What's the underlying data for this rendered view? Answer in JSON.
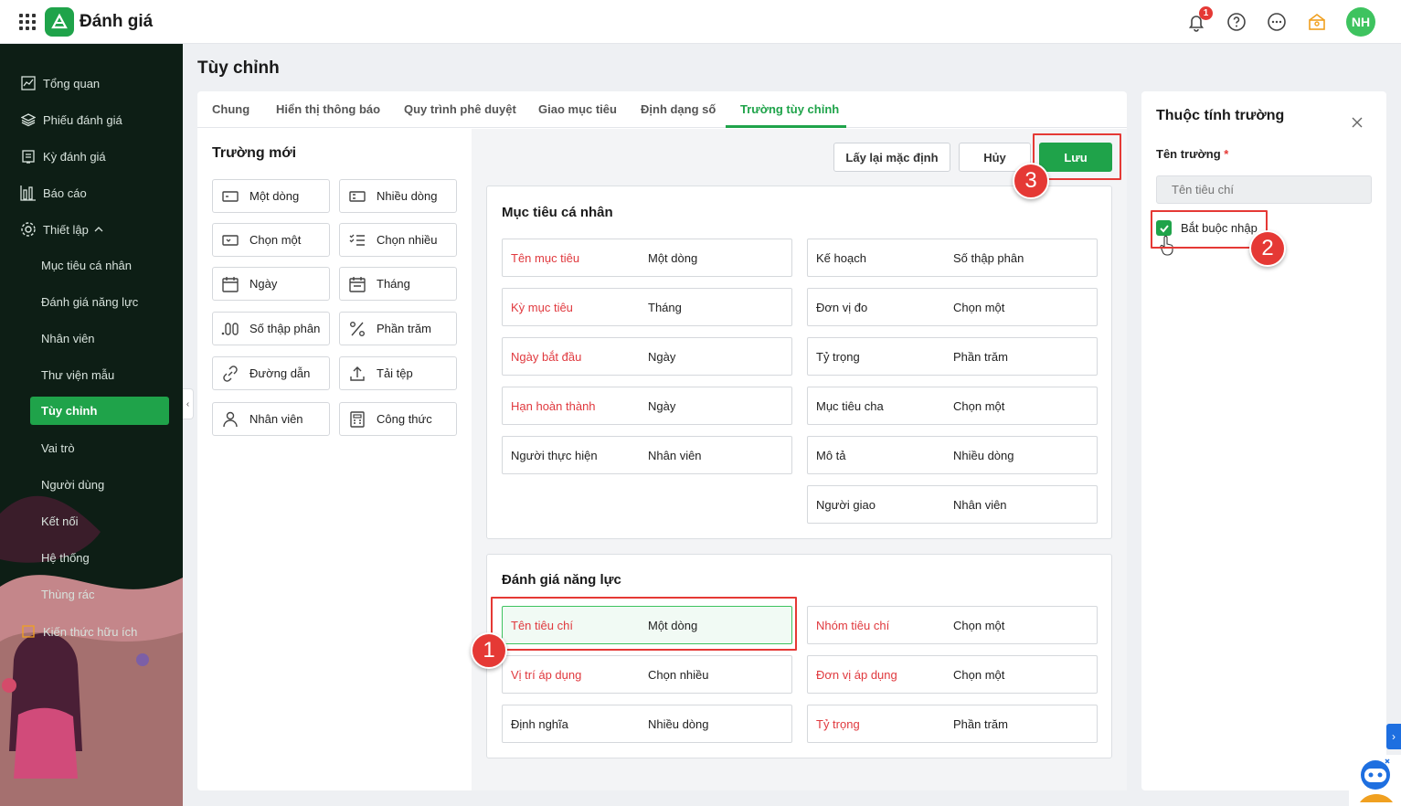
{
  "app": {
    "title": "Đánh giá",
    "notification_count": "1",
    "avatar_initials": "NH",
    "accent": "#1fa34a"
  },
  "sidebar": {
    "items": [
      {
        "label": "Tổng quan",
        "icon": "chart-icon"
      },
      {
        "label": "Phiếu đánh giá",
        "icon": "layers-icon"
      },
      {
        "label": "Kỳ đánh giá",
        "icon": "clipboard-icon"
      },
      {
        "label": "Báo cáo",
        "icon": "bar-chart-icon"
      },
      {
        "label": "Thiết lập",
        "icon": "gear-icon"
      }
    ],
    "sub_items": [
      "Mục tiêu cá nhân",
      "Đánh giá năng lực",
      "Nhân viên",
      "Thư viện mẫu",
      "Tùy chỉnh",
      "Vai trò",
      "Người dùng",
      "Kết nối",
      "Hệ thống",
      "Thùng rác",
      "Kiến thức hữu ích"
    ],
    "active": "Tùy chỉnh"
  },
  "page": {
    "title": "Tùy chỉnh"
  },
  "tabs": [
    "Chung",
    "Hiển thị thông báo",
    "Quy trình phê duyệt",
    "Giao mục tiêu",
    "Định dạng số",
    "Trường tùy chỉnh"
  ],
  "active_tab": "Trường tùy chỉnh",
  "new_fields": {
    "title": "Trường mới",
    "items": [
      "Một dòng",
      "Nhiều dòng",
      "Chọn một",
      "Chọn nhiều",
      "Ngày",
      "Tháng",
      "Số thập phân",
      "Phần trăm",
      "Đường dẫn",
      "Tải tệp",
      "Nhân viên",
      "Công thức"
    ]
  },
  "actions": {
    "reset": "Lấy lại mặc định",
    "cancel": "Hủy",
    "save": "Lưu"
  },
  "sections": [
    {
      "title": "Mục tiêu cá nhân",
      "left": [
        {
          "label": "Tên mục tiêu",
          "type": "Một dòng",
          "required": true
        },
        {
          "label": "Kỳ mục tiêu",
          "type": "Tháng",
          "required": true
        },
        {
          "label": "Ngày bắt đầu",
          "type": "Ngày",
          "required": true
        },
        {
          "label": "Hạn hoàn thành",
          "type": "Ngày",
          "required": true
        },
        {
          "label": "Người thực hiện",
          "type": "Nhân viên",
          "required": false
        }
      ],
      "right": [
        {
          "label": "Kế hoạch",
          "type": "Số thập phân",
          "required": false
        },
        {
          "label": "Đơn vị đo",
          "type": "Chọn một",
          "required": false
        },
        {
          "label": "Tỷ trọng",
          "type": "Phần trăm",
          "required": false
        },
        {
          "label": "Mục tiêu cha",
          "type": "Chọn một",
          "required": false
        },
        {
          "label": "Mô tả",
          "type": "Nhiều dòng",
          "required": false
        },
        {
          "label": "Người giao",
          "type": "Nhân viên",
          "required": false
        }
      ]
    },
    {
      "title": "Đánh giá năng lực",
      "left": [
        {
          "label": "Tên tiêu chí",
          "type": "Một dòng",
          "required": true
        },
        {
          "label": "Vị trí áp dụng",
          "type": "Chọn nhiều",
          "required": true
        },
        {
          "label": "Định nghĩa",
          "type": "Nhiều dòng",
          "required": false
        }
      ],
      "right": [
        {
          "label": "Nhóm tiêu chí",
          "type": "Chọn một",
          "required": true
        },
        {
          "label": "Đơn vị áp dụng",
          "type": "Chọn một",
          "required": true
        },
        {
          "label": "Tỷ trọng",
          "type": "Phần trăm",
          "required": true
        }
      ]
    }
  ],
  "properties": {
    "title": "Thuộc tính trường",
    "field_name_label": "Tên trường",
    "required_mark": "*",
    "field_name_placeholder": "Tên tiêu chí",
    "required_checkbox_label": "Bắt buộc nhập",
    "required_checked": true
  },
  "annotations": [
    "1",
    "2",
    "3"
  ]
}
